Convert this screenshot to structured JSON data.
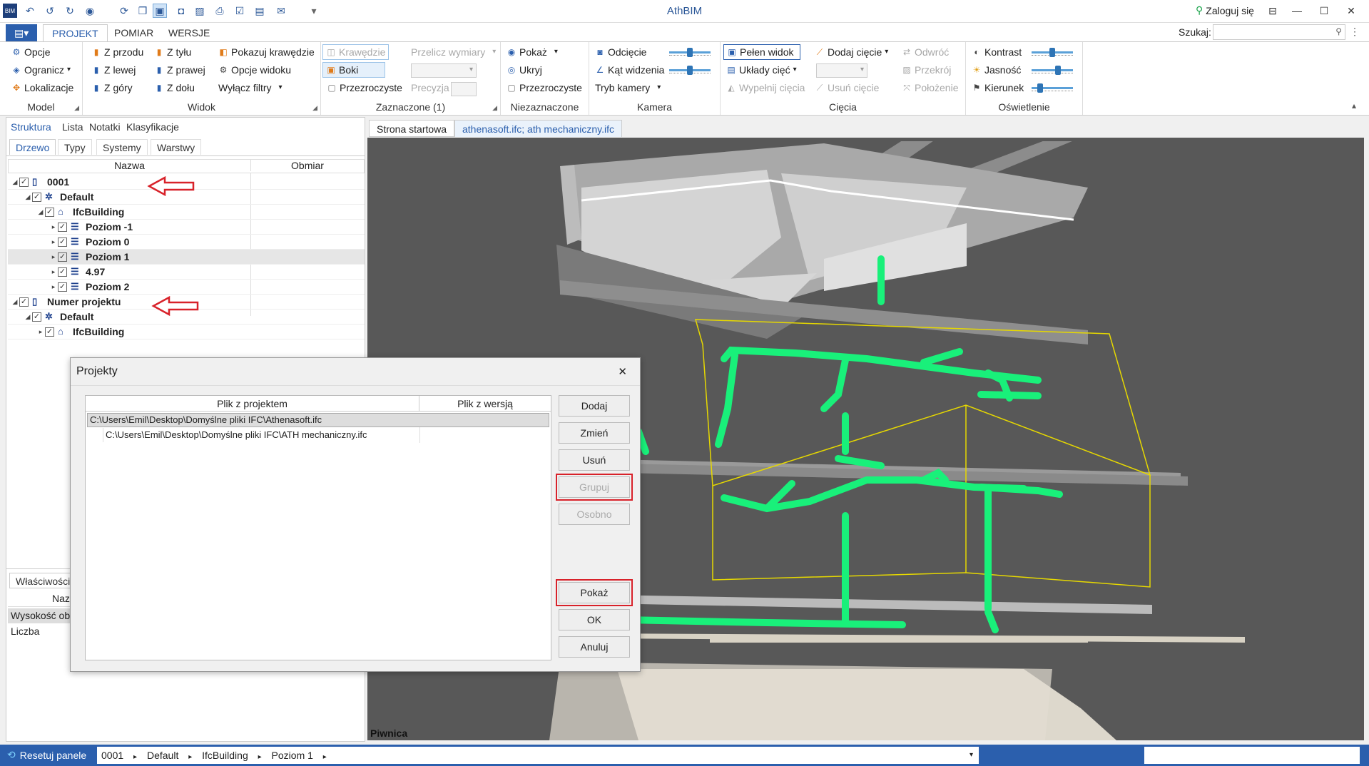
{
  "window": {
    "title": "AthBIM",
    "login_label": "Zaloguj się"
  },
  "ribbon_tabs": [
    "PROJEKT",
    "POMIAR",
    "WERSJE"
  ],
  "search_label": "Szukaj:",
  "ribbon": {
    "model": {
      "label": "Model",
      "items": [
        "Opcje",
        "Ogranicz",
        "Lokalizacje"
      ]
    },
    "widok": {
      "label": "Widok",
      "items": [
        "Z przodu",
        "Z lewej",
        "Z góry",
        "Z tyłu",
        "Z prawej",
        "Z dołu",
        "Pokazuj krawędzie",
        "Opcje widoku",
        "Wyłącz filtry"
      ]
    },
    "zaznaczone": {
      "label": "Zaznaczone (1)",
      "items": [
        "Krawędzie",
        "Boki",
        "Przezroczyste",
        "Przelicz wymiary",
        "Precyzja"
      ]
    },
    "niezaznaczone": {
      "label": "Niezaznaczone",
      "items": [
        "Pokaż",
        "Ukryj",
        "Przezroczyste"
      ]
    },
    "kamera": {
      "label": "Kamera",
      "items": [
        "Odcięcie",
        "Kąt widzenia",
        "Tryb kamery"
      ]
    },
    "ciecia": {
      "label": "Cięcia",
      "items": [
        "Pełen widok",
        "Układy cięć",
        "Wypełnij cięcia",
        "Dodaj cięcie",
        "Usuń cięcie",
        "Odwróć",
        "Przekrój",
        "Położenie"
      ]
    },
    "oswietlenie": {
      "label": "Oświetlenie",
      "items": [
        "Kontrast",
        "Jasność",
        "Kierunek"
      ]
    }
  },
  "left_panel": {
    "tabs": [
      "Struktura",
      "Lista",
      "Notatki",
      "Klasyfikacje"
    ],
    "subtabs": [
      "Drzewo",
      "Typy",
      "Systemy",
      "Warstwy"
    ],
    "columns": [
      "Nazwa",
      "Obmiar"
    ],
    "tree": [
      "0001",
      "Default",
      "IfcBuilding",
      "Poziom -1",
      "Poziom 0",
      "Poziom 1",
      "4.97",
      "Poziom 2",
      "Numer projektu",
      "Default",
      "IfcBuilding"
    ],
    "props_tab": "Właściwości",
    "props_col": "Naz",
    "props_rows": [
      "Wysokość ob",
      "Liczba"
    ]
  },
  "doc_tabs": [
    "Strona startowa",
    "athenasoft.ifc; ath mechaniczny.ifc"
  ],
  "viewport_label": "Piwnica",
  "dialog": {
    "title": "Projekty",
    "columns": [
      "Plik z projektem",
      "Plik z wersją"
    ],
    "rows": [
      "C:\\Users\\Emil\\Desktop\\Domyślne pliki IFC\\Athenasoft.ifc",
      "C:\\Users\\Emil\\Desktop\\Domyślne pliki IFC\\ATH mechaniczny.ifc"
    ],
    "buttons": [
      "Dodaj",
      "Zmień",
      "Usuń",
      "Grupuj",
      "Osobno",
      "Pokaż",
      "OK",
      "Anuluj"
    ]
  },
  "statusbar": {
    "reset_label": "Resetuj panele",
    "breadcrumb": [
      "0001",
      "Default",
      "IfcBuilding",
      "Poziom 1"
    ]
  },
  "colors": {
    "accent": "#2b5fad",
    "pipe": "#19f07a",
    "highlight_box": "#d8222a"
  }
}
